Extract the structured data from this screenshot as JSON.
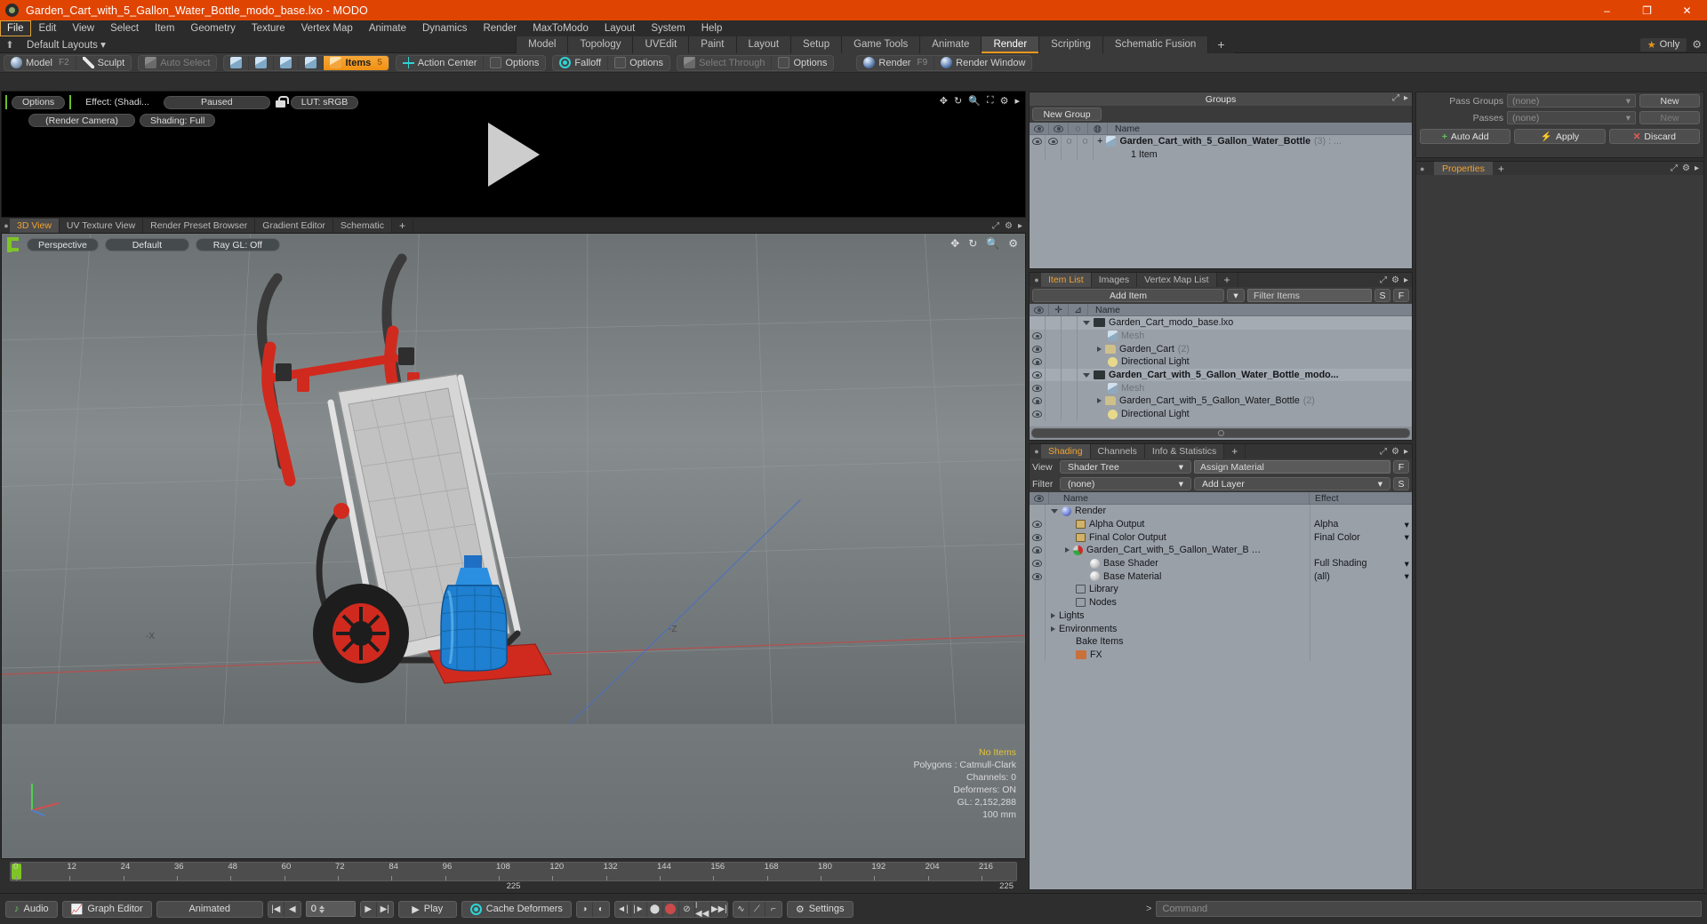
{
  "titlebar": {
    "title": "Garden_Cart_with_5_Gallon_Water_Bottle_modo_base.lxo - MODO",
    "minimize": "–",
    "maximize": "❐",
    "close": "✕"
  },
  "menubar": {
    "items": [
      "File",
      "Edit",
      "View",
      "Select",
      "Item",
      "Geometry",
      "Texture",
      "Vertex Map",
      "Animate",
      "Dynamics",
      "Render",
      "MaxToModo",
      "Layout",
      "System",
      "Help"
    ],
    "selected": "File"
  },
  "layoutbar": {
    "home_icon": "⬆",
    "default_layouts": "Default Layouts ▾",
    "tabs": [
      "Model",
      "Topology",
      "UVEdit",
      "Paint",
      "Layout",
      "Setup",
      "Game Tools",
      "Animate",
      "Render",
      "Scripting",
      "Schematic Fusion"
    ],
    "active_tab": "Render",
    "add_tab": "+",
    "only_label": "Only",
    "star": "★",
    "gear": "⚙"
  },
  "modebar": {
    "model": "Model",
    "model_key": "F2",
    "sculpt": "Sculpt",
    "auto_select": "Auto Select",
    "items": "Items",
    "items_key": "5",
    "action_center": "Action Center",
    "options1": "Options",
    "falloff": "Falloff",
    "options2": "Options",
    "select_through": "Select Through",
    "options3": "Options",
    "render": "Render",
    "render_key": "F9",
    "render_window": "Render Window"
  },
  "render_preview": {
    "options": "Options",
    "effect": "Effect: (Shadi...",
    "paused": "Paused",
    "lut": "LUT: sRGB",
    "camera": "(Render Camera)",
    "shading": "Shading: Full",
    "icons": [
      "move-icon",
      "rotate-icon",
      "zoom-icon",
      "fit-icon",
      "gear-icon",
      "chevron-right-icon"
    ]
  },
  "viewport": {
    "tabs": [
      "3D View",
      "UV Texture View",
      "Render Preset Browser",
      "Gradient Editor",
      "Schematic"
    ],
    "active_tab": "3D View",
    "add_tab": "+",
    "perspective": "Perspective",
    "default": "Default",
    "raygl": "Ray GL: Off",
    "axis_labels": {
      "x": "-X",
      "z": "-Z"
    },
    "stats": {
      "no_items": "No Items",
      "polygons": "Polygons : Catmull-Clark",
      "channels": "Channels: 0",
      "deformers": "Deformers: ON",
      "gl": "GL: 2,152,288",
      "scale": "100 mm"
    }
  },
  "timeline": {
    "ticks": [
      "0",
      "12",
      "24",
      "36",
      "48",
      "60",
      "72",
      "84",
      "96",
      "108",
      "120",
      "132",
      "144",
      "156",
      "168",
      "180",
      "192",
      "204",
      "216"
    ],
    "center_label": "225",
    "right_label": "225"
  },
  "groups_panel": {
    "title": "Groups",
    "new_group": "New Group",
    "columns": [
      "eye",
      "shade",
      "poly1",
      "poly2",
      "Name"
    ],
    "rows": [
      {
        "name": "Garden_Cart_with_5_Gallon_Water_Bottle",
        "count": "(3) : ...",
        "sub": "1 Item",
        "expander": "+"
      }
    ]
  },
  "item_list_panel": {
    "tabs": [
      "Item List",
      "Images",
      "Vertex Map List"
    ],
    "active_tab": "Item List",
    "add_tab": "+",
    "add_item": "Add Item",
    "filter_placeholder": "Filter Items",
    "filter_value": "",
    "btn_s": "S",
    "btn_f": "F",
    "columns": [
      "eye",
      "lock",
      "axis",
      "Name"
    ],
    "rows": [
      {
        "name": "Garden_Cart_modo_base.lxo",
        "icon": "film-icon",
        "indent": 0,
        "expander": "down",
        "eye": false,
        "style": "scene"
      },
      {
        "name": "Mesh",
        "icon": "mesh-icon",
        "indent": 1,
        "expander": "none",
        "eye": true,
        "style": "dim"
      },
      {
        "name": "Garden_Cart",
        "suffix": "(2)",
        "icon": "folder-icon",
        "indent": 1,
        "expander": "right",
        "eye": true,
        "style": "normal"
      },
      {
        "name": "Directional Light",
        "icon": "light-icon",
        "indent": 1,
        "expander": "none",
        "eye": true,
        "style": "normal"
      },
      {
        "name": "Garden_Cart_with_5_Gallon_Water_Bottle_modo...",
        "icon": "film-icon",
        "indent": 0,
        "expander": "down",
        "eye": true,
        "style": "bold"
      },
      {
        "name": "Mesh",
        "icon": "mesh-icon",
        "indent": 1,
        "expander": "none",
        "eye": true,
        "style": "dim"
      },
      {
        "name": "Garden_Cart_with_5_Gallon_Water_Bottle",
        "suffix": "(2)",
        "icon": "folder-icon",
        "indent": 1,
        "expander": "right",
        "eye": true,
        "style": "normal"
      },
      {
        "name": "Directional Light",
        "icon": "light-icon",
        "indent": 1,
        "expander": "none",
        "eye": true,
        "style": "normal"
      }
    ]
  },
  "shading_panel": {
    "tabs": [
      "Shading",
      "Channels",
      "Info & Statistics"
    ],
    "active_tab": "Shading",
    "add_tab": "+",
    "view_label": "View",
    "view_value": "Shader Tree",
    "assign_material": "Assign Material",
    "assign_f": "F",
    "filter_label": "Filter",
    "filter_value": "(none)",
    "add_layer": "Add Layer",
    "add_layer_s": "S",
    "columns": [
      "eye",
      "Name",
      "Effect"
    ],
    "rows": [
      {
        "name": "Render",
        "icon": "sphere-icon",
        "indent": 0,
        "expander": "down",
        "eye": false,
        "effect": ""
      },
      {
        "name": "Alpha Output",
        "icon": "image-icon",
        "indent": 1,
        "expander": "none",
        "eye": true,
        "effect": "Alpha"
      },
      {
        "name": "Final Color Output",
        "icon": "image-icon",
        "indent": 1,
        "expander": "none",
        "eye": true,
        "effect": "Final Color"
      },
      {
        "name": "Garden_Cart_with_5_Gallon_Water_B …",
        "icon": "material-icon",
        "indent": 1,
        "expander": "right",
        "eye": true,
        "effect": ""
      },
      {
        "name": "Base Shader",
        "icon": "grey-sphere-icon",
        "indent": 2,
        "expander": "none",
        "eye": true,
        "effect": "Full Shading"
      },
      {
        "name": "Base Material",
        "icon": "grey-sphere-icon",
        "indent": 2,
        "expander": "none",
        "eye": true,
        "effect": "(all)"
      },
      {
        "name": "Library",
        "icon": "node-icon",
        "indent": 1,
        "expander": "none",
        "eye": false,
        "effect": ""
      },
      {
        "name": "Nodes",
        "icon": "node-icon",
        "indent": 1,
        "expander": "none",
        "eye": false,
        "effect": ""
      },
      {
        "name": "Lights",
        "icon": "",
        "indent": 0,
        "expander": "right",
        "eye": false,
        "effect": ""
      },
      {
        "name": "Environments",
        "icon": "",
        "indent": 0,
        "expander": "right",
        "eye": false,
        "effect": ""
      },
      {
        "name": "Bake Items",
        "icon": "",
        "indent": 1,
        "expander": "none",
        "eye": false,
        "effect": ""
      },
      {
        "name": "FX",
        "icon": "fx-icon",
        "indent": 1,
        "expander": "none",
        "eye": false,
        "effect": ""
      }
    ]
  },
  "pass_panel": {
    "pass_groups_label": "Pass Groups",
    "pass_groups_value": "(none)",
    "passes_label": "Passes",
    "passes_value": "(none)",
    "new1": "New",
    "new2": "New",
    "auto_add": "Auto Add",
    "apply": "Apply",
    "discard": "Discard",
    "properties_tab": "Properties",
    "properties_plus": "+"
  },
  "bottombar": {
    "audio": "Audio",
    "graph_editor": "Graph Editor",
    "animated": "Animated",
    "frame_value": "0",
    "play": "Play",
    "cache_deformers": "Cache Deformers",
    "settings": "Settings"
  },
  "command_bar": {
    "prompt": ">",
    "placeholder": "Command",
    "value": ""
  },
  "colors": {
    "accent_orange": "#e8971c",
    "title_orange": "#e04403",
    "panel_bg": "#3a3a3a",
    "list_bg": "#9aa0a8",
    "viewport_grey": "#7b8183"
  }
}
